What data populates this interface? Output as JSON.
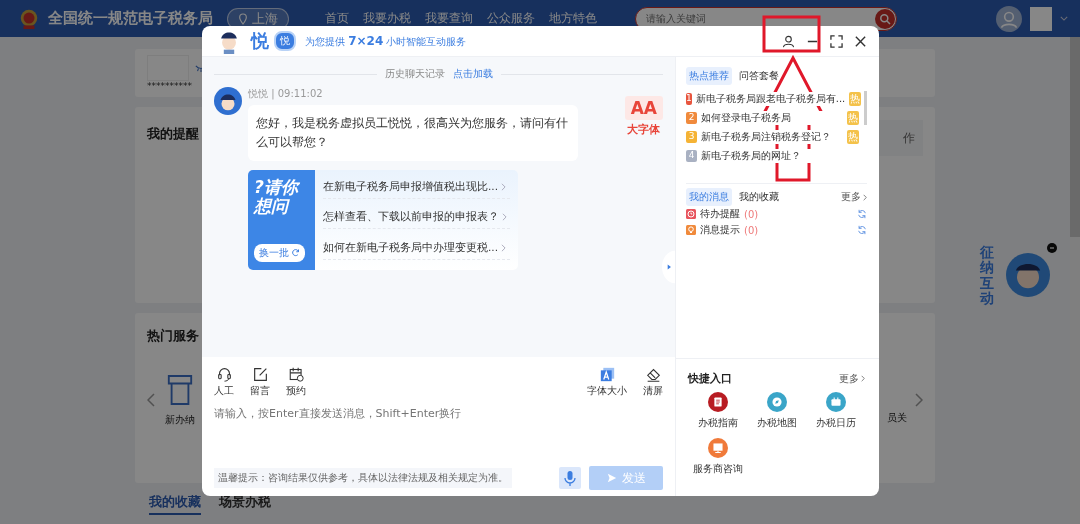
{
  "header": {
    "site_title": "全国统一规范电子税务局",
    "location": "上海",
    "nav": [
      "首页",
      "我要办税",
      "我要查询",
      "公众服务",
      "地方特色"
    ],
    "search": {
      "placeholder": "请输入关键词"
    }
  },
  "background": {
    "masked_value": "**********",
    "reminders_title": "我的提醒",
    "right_button": "作",
    "hot_services_title": "热门服务",
    "service_label": "新办纳",
    "right_service_label": "员关",
    "tabs": [
      {
        "label": "我的收藏",
        "selected": true
      },
      {
        "label": "场景办税",
        "selected": false
      }
    ],
    "widget_text": "征纳互动"
  },
  "chat": {
    "brand": "悦",
    "badge": "悦",
    "tagline": "为您提供 **7×24** 小时智能互动服务",
    "history_label": "历史聊天记录",
    "history_link": "点击加载",
    "message": {
      "sender": "悦悦 | 09:11:02",
      "text": "您好，我是税务虚拟员工悦悦，很高兴为您服务，请问有什么可以帮您？"
    },
    "font_toggle": {
      "glyph": "AA",
      "label": "大字体"
    },
    "suggestions": {
      "title": "?请你想问",
      "refresh": "换一批",
      "questions": [
        "在新电子税务局申报增值税出现比...",
        "怎样查看、下载以前申报的申报表？",
        "如何在新电子税务局中办理变更税..."
      ]
    },
    "tools_left": [
      {
        "kind": "agent",
        "label": "人工"
      },
      {
        "kind": "note",
        "label": "留言"
      },
      {
        "kind": "booking",
        "label": "预约"
      }
    ],
    "tools_right": [
      {
        "kind": "font",
        "label": "字体大小"
      },
      {
        "kind": "clear",
        "label": "清屏"
      }
    ],
    "input": {
      "placeholder": "请输入，按Enter直接发送消息，Shift+Enter换行"
    },
    "notice": "温馨提示：咨询结果仅供参考，具体以法律法规及相关规定为准。",
    "send": {
      "label": "发送",
      "disabled": true
    }
  },
  "panel": {
    "tabs": [
      {
        "label": "热点推荐",
        "selected": true
      },
      {
        "label": "问答套餐",
        "selected": false
      }
    ],
    "hot_list": [
      {
        "number": "1",
        "color": "#e8553e",
        "text": "新电子税务局跟老电子税务局有...",
        "badge": "热"
      },
      {
        "number": "2",
        "color": "#f08a3c",
        "text": "如何登录电子税务局",
        "badge": "热"
      },
      {
        "number": "3",
        "color": "#f5b335",
        "text": "新电子税务局注销税务登记？",
        "badge": "热"
      },
      {
        "number": "4",
        "color": "#a9b1c2",
        "text": "新电子税务局的网址？"
      }
    ],
    "message_tabs": [
      {
        "label": "我的消息",
        "selected": true
      },
      {
        "label": "我的收藏",
        "selected": false
      }
    ],
    "message_more": "更多",
    "messages": [
      {
        "kind": "todo",
        "label": "待办提醒",
        "count": "(0)"
      },
      {
        "kind": "tip",
        "label": "消息提示",
        "count": "(0)"
      }
    ],
    "quick_title": "快捷入口",
    "quick_more": "更多",
    "quick": [
      {
        "kind": "guide",
        "label": "办税指南",
        "color": "#b81c22"
      },
      {
        "kind": "map",
        "label": "办税地图",
        "color": "#3aa5c8"
      },
      {
        "kind": "calendar",
        "label": "办税日历",
        "color": "#3aa5c8"
      },
      {
        "kind": "consult",
        "label": "服务商咨询",
        "color": "#f07a3a"
      }
    ]
  }
}
